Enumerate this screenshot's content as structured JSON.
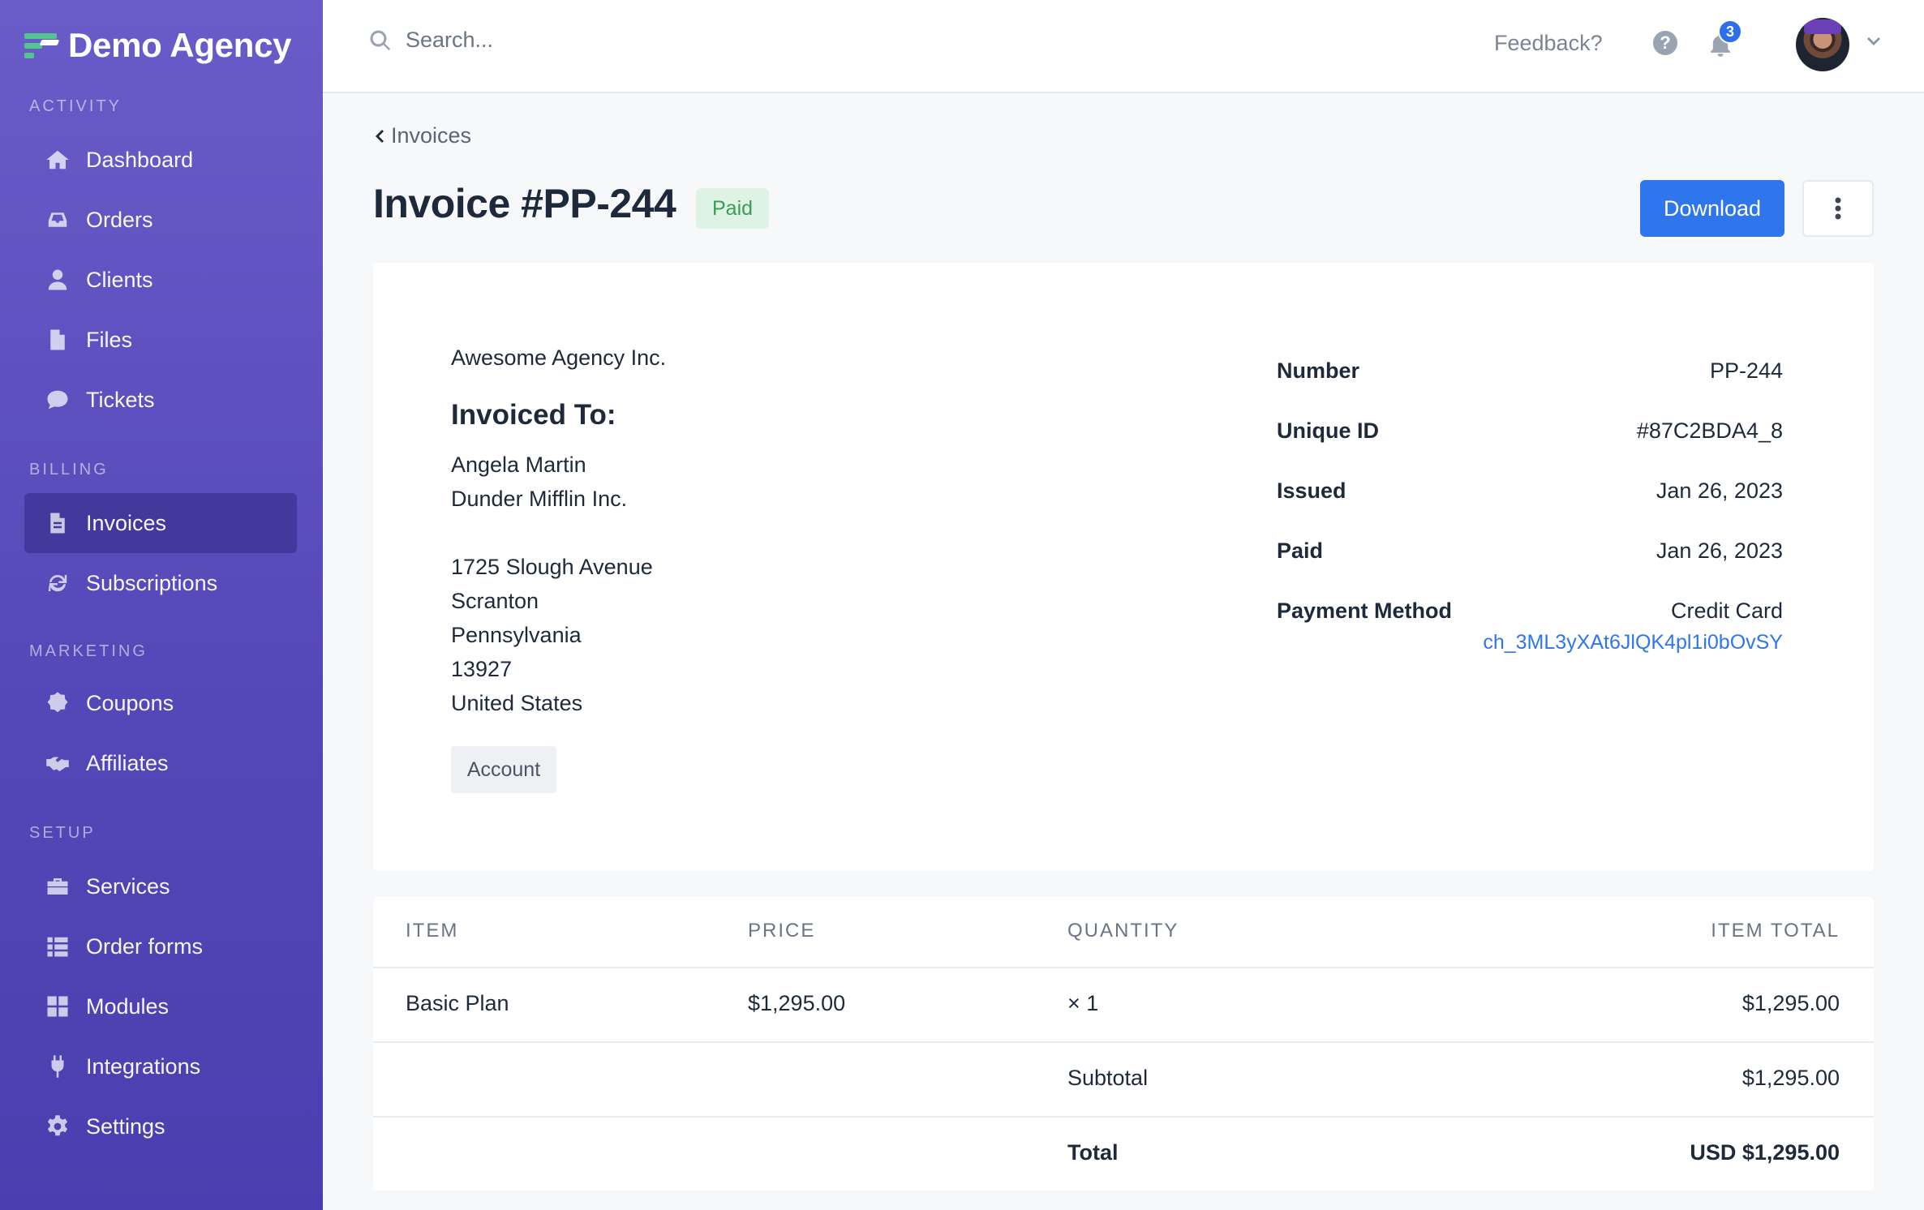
{
  "brand": {
    "name": "Demo Agency"
  },
  "sidebar": {
    "sections": [
      {
        "label": "Activity"
      },
      {
        "label": "Billing"
      },
      {
        "label": "Marketing"
      },
      {
        "label": "Setup"
      }
    ],
    "items": [
      {
        "label": "Dashboard",
        "icon": "home-icon"
      },
      {
        "label": "Orders",
        "icon": "inbox-icon"
      },
      {
        "label": "Clients",
        "icon": "user-icon"
      },
      {
        "label": "Files",
        "icon": "file-icon"
      },
      {
        "label": "Tickets",
        "icon": "chat-icon"
      },
      {
        "label": "Invoices",
        "icon": "invoice-icon",
        "active": true
      },
      {
        "label": "Subscriptions",
        "icon": "refresh-icon"
      },
      {
        "label": "Coupons",
        "icon": "coupon-icon"
      },
      {
        "label": "Affiliates",
        "icon": "handshake-icon"
      },
      {
        "label": "Services",
        "icon": "toolbox-icon"
      },
      {
        "label": "Order forms",
        "icon": "list-icon"
      },
      {
        "label": "Modules",
        "icon": "grid-icon"
      },
      {
        "label": "Integrations",
        "icon": "plug-icon"
      },
      {
        "label": "Settings",
        "icon": "gear-icon"
      }
    ]
  },
  "topbar": {
    "search_placeholder": "Search...",
    "feedback": "Feedback?",
    "help": "?",
    "notifications_count": "3"
  },
  "page": {
    "back_label": "Invoices",
    "title": "Invoice #PP-244",
    "status": "Paid",
    "download_label": "Download"
  },
  "invoice": {
    "from": "Awesome Agency Inc.",
    "invoiced_to_heading": "Invoiced To:",
    "to_name": "Angela Martin",
    "to_company": "Dunder Mifflin Inc.",
    "address": [
      "1725 Slough Avenue",
      "Scranton",
      "Pennsylvania",
      "13927",
      "United States"
    ],
    "account_button": "Account",
    "meta": [
      {
        "label": "Number",
        "value": "PP-244"
      },
      {
        "label": "Unique ID",
        "value": "#87C2BDA4_8"
      },
      {
        "label": "Issued",
        "value": "Jan 26, 2023"
      },
      {
        "label": "Paid",
        "value": "Jan 26, 2023"
      },
      {
        "label": "Payment Method",
        "value": "Credit Card"
      }
    ],
    "payment_ref": "ch_3ML3yXAt6JlQK4pl1i0bOvSY"
  },
  "items_table": {
    "headers": [
      "Item",
      "Price",
      "Quantity",
      "Item total"
    ],
    "rows": [
      {
        "item": "Basic Plan",
        "price": "$1,295.00",
        "quantity": "× 1",
        "total": "$1,295.00"
      }
    ],
    "subtotal_label": "Subtotal",
    "subtotal_value": "$1,295.00",
    "total_label": "Total",
    "total_value": "USD $1,295.00"
  },
  "colors": {
    "sidebar_top": "#6a5cc8",
    "sidebar_bottom": "#4a3fb0",
    "primary": "#2f76ec",
    "paid_bg": "#dff3e4",
    "paid_text": "#3e9b57"
  }
}
